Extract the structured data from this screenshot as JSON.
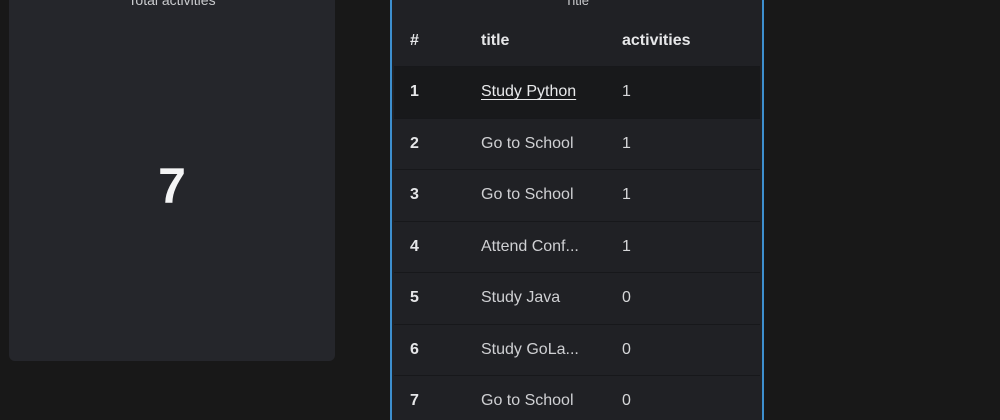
{
  "stat_card": {
    "title": "Total activities",
    "value": "7"
  },
  "table_panel": {
    "title": "Title",
    "headers": {
      "num": "#",
      "title": "title",
      "activities": "activities"
    },
    "rows": [
      {
        "num": "1",
        "title": "Study Python",
        "activities": "1",
        "link": true
      },
      {
        "num": "2",
        "title": "Go to School",
        "activities": "1"
      },
      {
        "num": "3",
        "title": "Go to School",
        "activities": "1"
      },
      {
        "num": "4",
        "title": "Attend Conf...",
        "activities": "1"
      },
      {
        "num": "5",
        "title": "Study Java",
        "activities": "0"
      },
      {
        "num": "6",
        "title": "Study GoLa...",
        "activities": "0"
      },
      {
        "num": "7",
        "title": "Go to School",
        "activities": "0"
      }
    ]
  },
  "colors": {
    "background": "#181818",
    "card": "#25262b",
    "panel_border": "#3d8fce"
  }
}
